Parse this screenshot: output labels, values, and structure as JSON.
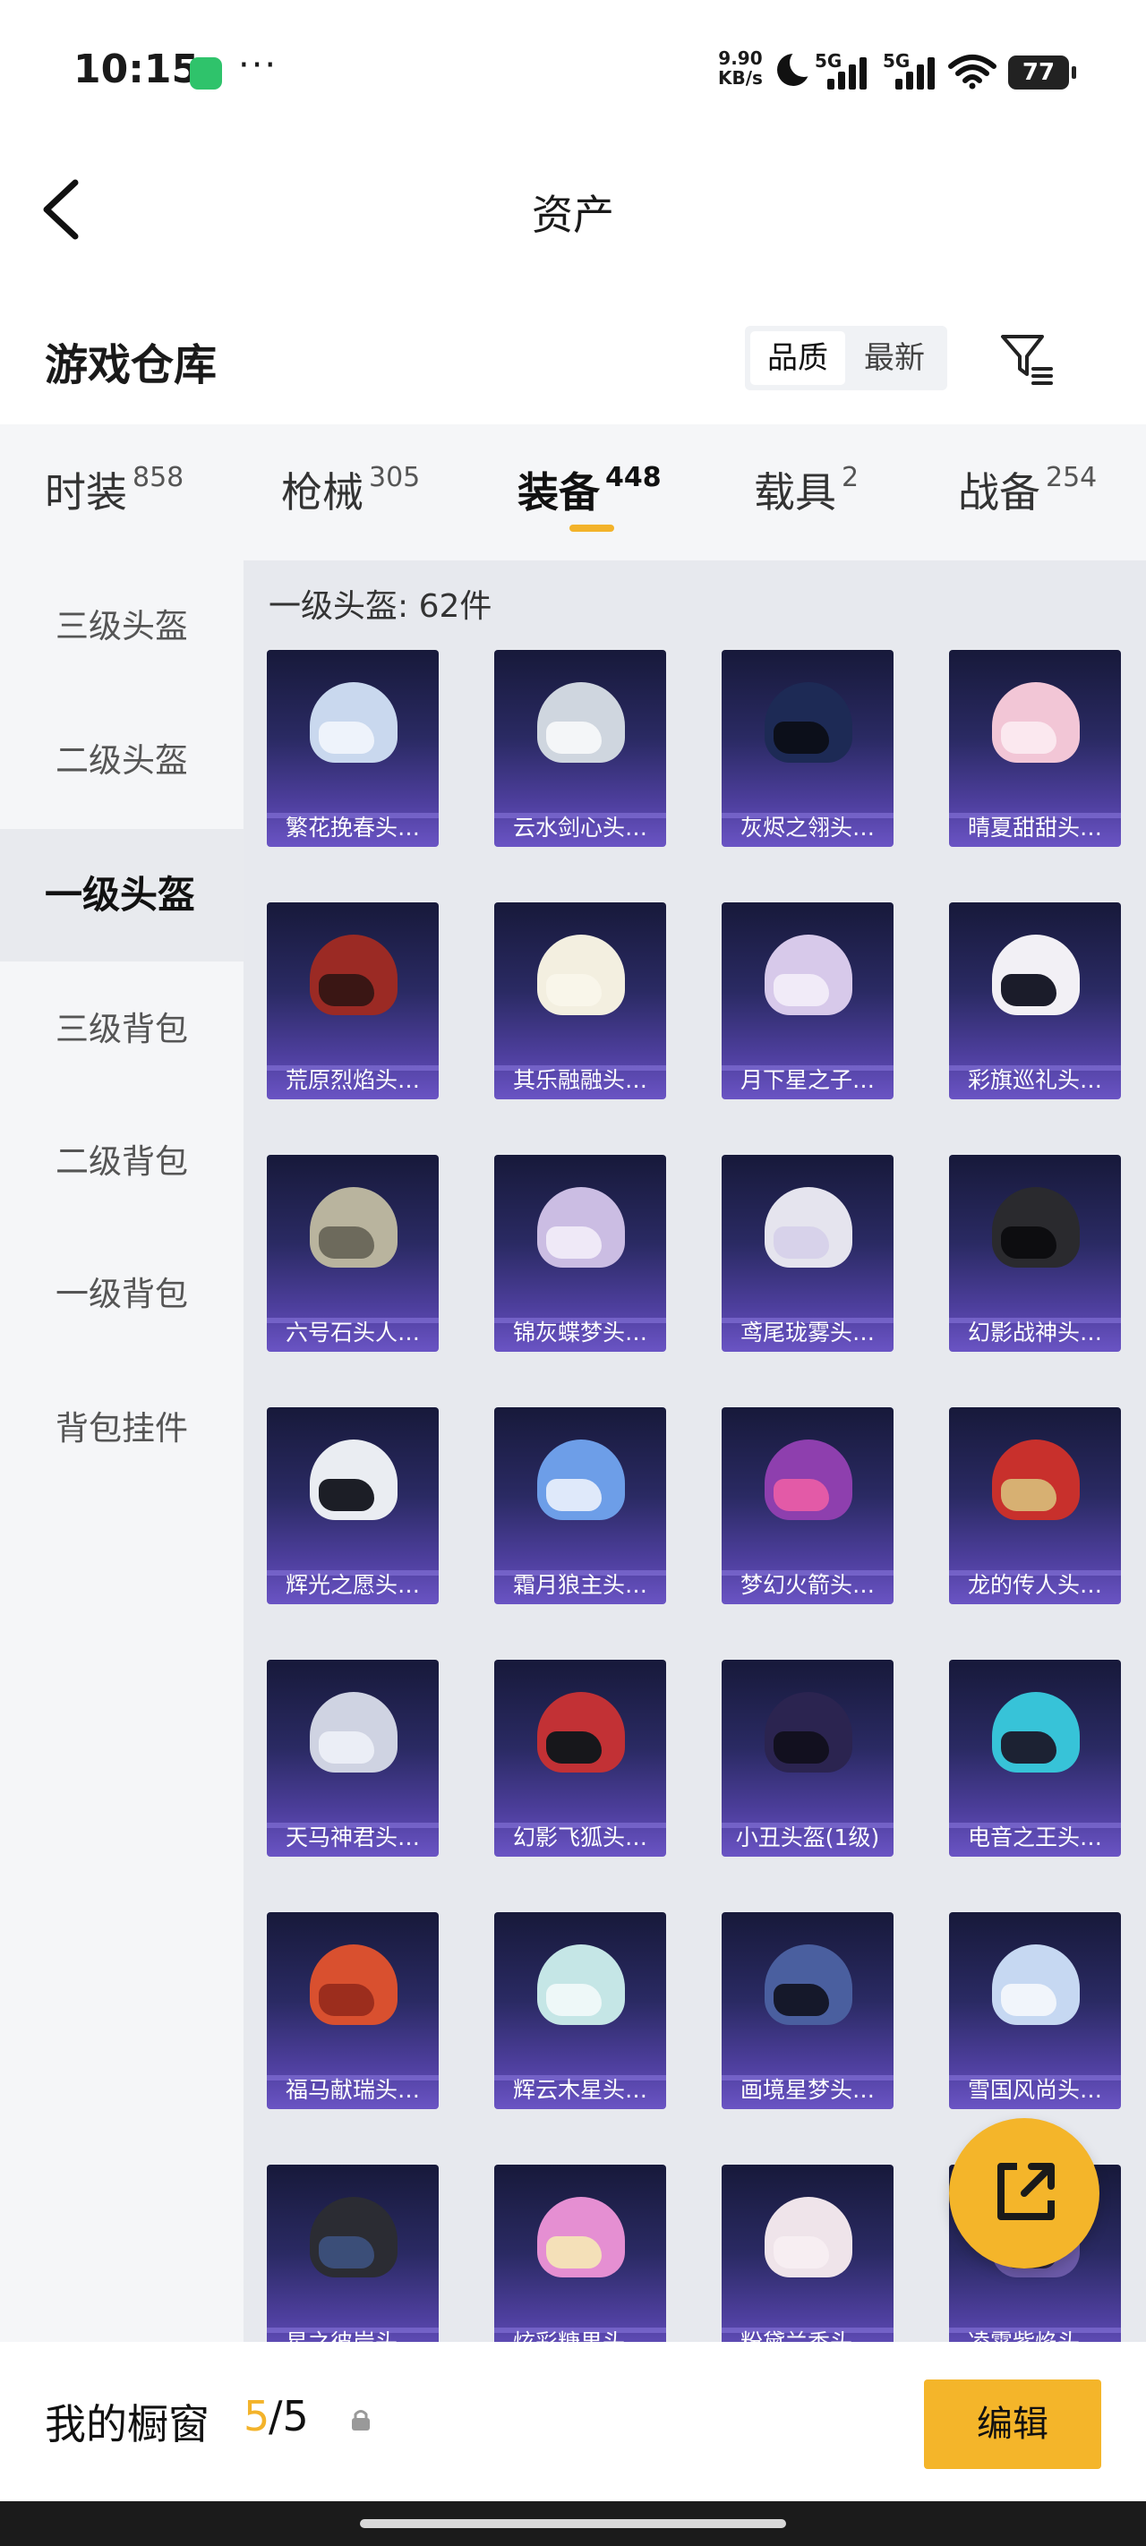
{
  "status": {
    "time": "10:15",
    "speed": [
      "9.90",
      "KB/s"
    ],
    "network1": "5G",
    "network2": "5G",
    "battery": "77"
  },
  "header": {
    "title": "资产"
  },
  "warehouse": {
    "title": "游戏仓库",
    "sort": [
      "品质",
      "最新"
    ]
  },
  "tabs": [
    {
      "label": "时装",
      "count": "858"
    },
    {
      "label": "枪械",
      "count": "305"
    },
    {
      "label": "装备",
      "count": "448"
    },
    {
      "label": "载具",
      "count": "2"
    },
    {
      "label": "战备",
      "count": "254"
    }
  ],
  "side_menu": [
    "三级头盔",
    "二级头盔",
    "一级头盔",
    "三级背包",
    "二级背包",
    "一级背包",
    "背包挂件"
  ],
  "grid": {
    "count_text": "一级头盔: 62件",
    "items": [
      {
        "name": "繁花挽春头…",
        "shell": "#c9d8ee",
        "visor": "#eef3fb"
      },
      {
        "name": "云水剑心头…",
        "shell": "#cfd6df",
        "visor": "#f4f6f8"
      },
      {
        "name": "灰烬之翎头…",
        "shell": "#1d2a55",
        "visor": "#0c0f1a"
      },
      {
        "name": "晴夏甜甜头…",
        "shell": "#f2c6d6",
        "visor": "#fbe8ef"
      },
      {
        "name": "荒原烈焰头…",
        "shell": "#9b2a24",
        "visor": "#3a1614"
      },
      {
        "name": "其乐融融头…",
        "shell": "#f3efe0",
        "visor": "#f9f6ea"
      },
      {
        "name": "月下星之子…",
        "shell": "#d7c9ea",
        "visor": "#f1ebf8"
      },
      {
        "name": "彩旗巡礼头…",
        "shell": "#f2f0f5",
        "visor": "#1b1c2a"
      },
      {
        "name": "六号石头人…",
        "shell": "#b9b49e",
        "visor": "#6d6a5c"
      },
      {
        "name": "锦灰蝶梦头…",
        "shell": "#cbbde3",
        "visor": "#efe9f7"
      },
      {
        "name": "鸢尾珑雾头…",
        "shell": "#e5e4ee",
        "visor": "#d7d2ea"
      },
      {
        "name": "幻影战神头…",
        "shell": "#2a2a2e",
        "visor": "#0d0d10"
      },
      {
        "name": "辉光之愿头…",
        "shell": "#eaedf2",
        "visor": "#1c1e26"
      },
      {
        "name": "霜月狼主头…",
        "shell": "#6d9ee8",
        "visor": "#dfe9fa"
      },
      {
        "name": "梦幻火箭头…",
        "shell": "#8e3fae",
        "visor": "#e35aa7"
      },
      {
        "name": "龙的传人头…",
        "shell": "#c8302c",
        "visor": "#d7b072"
      },
      {
        "name": "天马神君头…",
        "shell": "#cfd3e2",
        "visor": "#ebeef6"
      },
      {
        "name": "幻影飞狐头…",
        "shell": "#c23135",
        "visor": "#17171b"
      },
      {
        "name": "小丑头盔(1级)",
        "shell": "#2b2450",
        "visor": "#12101f"
      },
      {
        "name": "电音之王头…",
        "shell": "#37c3d8",
        "visor": "#1c2233"
      },
      {
        "name": "福马献瑞头…",
        "shell": "#d9502f",
        "visor": "#9c2d1d"
      },
      {
        "name": "辉云木星头…",
        "shell": "#c5e6e6",
        "visor": "#eef8f8"
      },
      {
        "name": "画境星梦头…",
        "shell": "#4a5f9f",
        "visor": "#15182a"
      },
      {
        "name": "雪国风尚头…",
        "shell": "#c6d8f2",
        "visor": "#f1f5fb"
      },
      {
        "name": "星之彼岸头…",
        "shell": "#2b2c33",
        "visor": "#3b4e78"
      },
      {
        "name": "炫彩糖果头…",
        "shell": "#e58fd2",
        "visor": "#f4e0b8"
      },
      {
        "name": "粉黛兰香头…",
        "shell": "#efe4ea",
        "visor": "#f7eef2"
      },
      {
        "name": "凌霄紫焰头…",
        "shell": "#6b5aa8",
        "visor": "#2b2440"
      }
    ]
  },
  "bottom": {
    "label": "我的橱窗",
    "current": "5",
    "total": "/5",
    "edit": "编辑"
  },
  "colors": {
    "accent": "#f4b52a",
    "card_top": "#17193a",
    "card_bottom": "#6a54c4"
  }
}
